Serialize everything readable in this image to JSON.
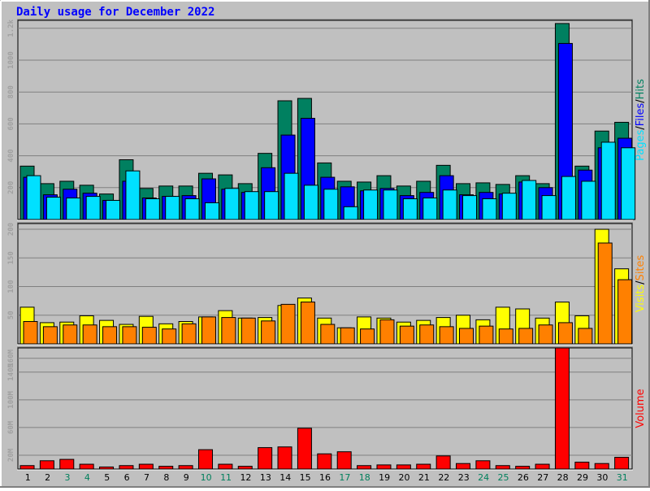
{
  "chart_data": {
    "type": "bar",
    "title": "Daily usage for December 2022",
    "colors": {
      "background": "#c0c0c0",
      "frame_light": "#ffffff",
      "frame_dark": "#808080",
      "title": "#0000ff",
      "grid": "#808080",
      "hits": "#008060",
      "files": "#0000ff",
      "pages": "#00e0ff",
      "visits": "#ffff00",
      "sites": "#ff8000",
      "volume": "#ff0000",
      "weekend_label": "#00805c",
      "weekday_label": "#000000"
    },
    "categories": [
      "1",
      "2",
      "3",
      "4",
      "5",
      "6",
      "7",
      "8",
      "9",
      "10",
      "11",
      "12",
      "13",
      "14",
      "15",
      "16",
      "17",
      "18",
      "19",
      "20",
      "21",
      "22",
      "23",
      "24",
      "25",
      "26",
      "27",
      "28",
      "29",
      "30",
      "31"
    ],
    "weekend_days": [
      "3",
      "4",
      "10",
      "11",
      "17",
      "18",
      "24",
      "25",
      "31"
    ],
    "panels": [
      {
        "ylim": [
          0,
          1250
        ],
        "ticks": [
          {
            "v": 200,
            "label": "200"
          },
          {
            "v": 400,
            "label": "400"
          },
          {
            "v": 600,
            "label": "600"
          },
          {
            "v": 800,
            "label": "800"
          },
          {
            "v": 1000,
            "label": "1000"
          },
          {
            "v": 1200,
            "label": "1.2k"
          }
        ],
        "legend": [
          {
            "text": "Pages",
            "color": "#00e0ff"
          },
          {
            "text": "/",
            "color": "#000000"
          },
          {
            "text": "Files",
            "color": "#0000ff"
          },
          {
            "text": "/",
            "color": "#000000"
          },
          {
            "text": "Hits",
            "color": "#008060"
          }
        ],
        "series": [
          {
            "name": "Hits",
            "color": "#008060",
            "values": [
              335,
              225,
              240,
              215,
              160,
              375,
              195,
              210,
              210,
              290,
              280,
              225,
              415,
              745,
              760,
              355,
              240,
              235,
              275,
              210,
              240,
              340,
              225,
              230,
              220,
              275,
              225,
              1230,
              335,
              555,
              610
            ]
          },
          {
            "name": "Files",
            "color": "#0000ff",
            "values": [
              265,
              155,
              190,
              165,
              120,
              240,
              135,
              145,
              150,
              255,
              190,
              170,
              325,
              530,
              635,
              265,
              205,
              180,
              195,
              150,
              170,
              275,
              155,
              170,
              160,
              235,
              200,
              1105,
              310,
              450,
              510
            ]
          },
          {
            "name": "Pages",
            "color": "#00e0ff",
            "values": [
              275,
              140,
              135,
              145,
              120,
              305,
              130,
              145,
              130,
              105,
              195,
              175,
              175,
              290,
              215,
              190,
              80,
              185,
              185,
              130,
              135,
              185,
              150,
              130,
              165,
              245,
              150,
              270,
              240,
              485,
              450
            ]
          }
        ]
      },
      {
        "ylim": [
          0,
          210
        ],
        "ticks": [
          {
            "v": 50,
            "label": "50"
          },
          {
            "v": 100,
            "label": "100"
          },
          {
            "v": 150,
            "label": "150"
          },
          {
            "v": 200,
            "label": "200"
          }
        ],
        "legend": [
          {
            "text": "Visits",
            "color": "#ffff00"
          },
          {
            "text": "/",
            "color": "#000000"
          },
          {
            "text": "Sites",
            "color": "#ff8000"
          }
        ],
        "series": [
          {
            "name": "Visits",
            "color": "#ffff00",
            "values": [
              64,
              37,
              38,
              49,
              41,
              34,
              48,
              35,
              39,
              47,
              58,
              45,
              46,
              67,
              80,
              45,
              28,
              47,
              45,
              38,
              41,
              46,
              50,
              42,
              64,
              61,
              45,
              73,
              49,
              200,
              131
            ]
          },
          {
            "name": "Sites",
            "color": "#ff8000",
            "values": [
              39,
              30,
              33,
              33,
              30,
              30,
              29,
              26,
              35,
              47,
              46,
              45,
              40,
              69,
              73,
              34,
              28,
              26,
              42,
              31,
              33,
              30,
              27,
              31,
              26,
              27,
              33,
              37,
              27,
              176,
              112
            ]
          }
        ]
      },
      {
        "ylim": [
          0,
          175
        ],
        "ticks": [
          {
            "v": 20,
            "label": "20M"
          },
          {
            "v": 60,
            "label": "60M"
          },
          {
            "v": 100,
            "label": "100M"
          },
          {
            "v": 140,
            "label": "140M"
          },
          {
            "v": 160,
            "label": "160M"
          }
        ],
        "legend": [
          {
            "text": "Volume",
            "color": "#ff0000"
          }
        ],
        "series": [
          {
            "name": "Volume",
            "color": "#ff0000",
            "values": [
              5,
              12,
              14,
              7,
              3,
              5,
              7,
              4,
              5,
              28,
              7,
              4,
              31,
              32,
              59,
              22,
              25,
              5,
              6,
              6,
              7,
              19,
              8,
              12,
              5,
              4,
              7,
              175,
              10,
              8,
              17
            ]
          }
        ]
      }
    ]
  }
}
